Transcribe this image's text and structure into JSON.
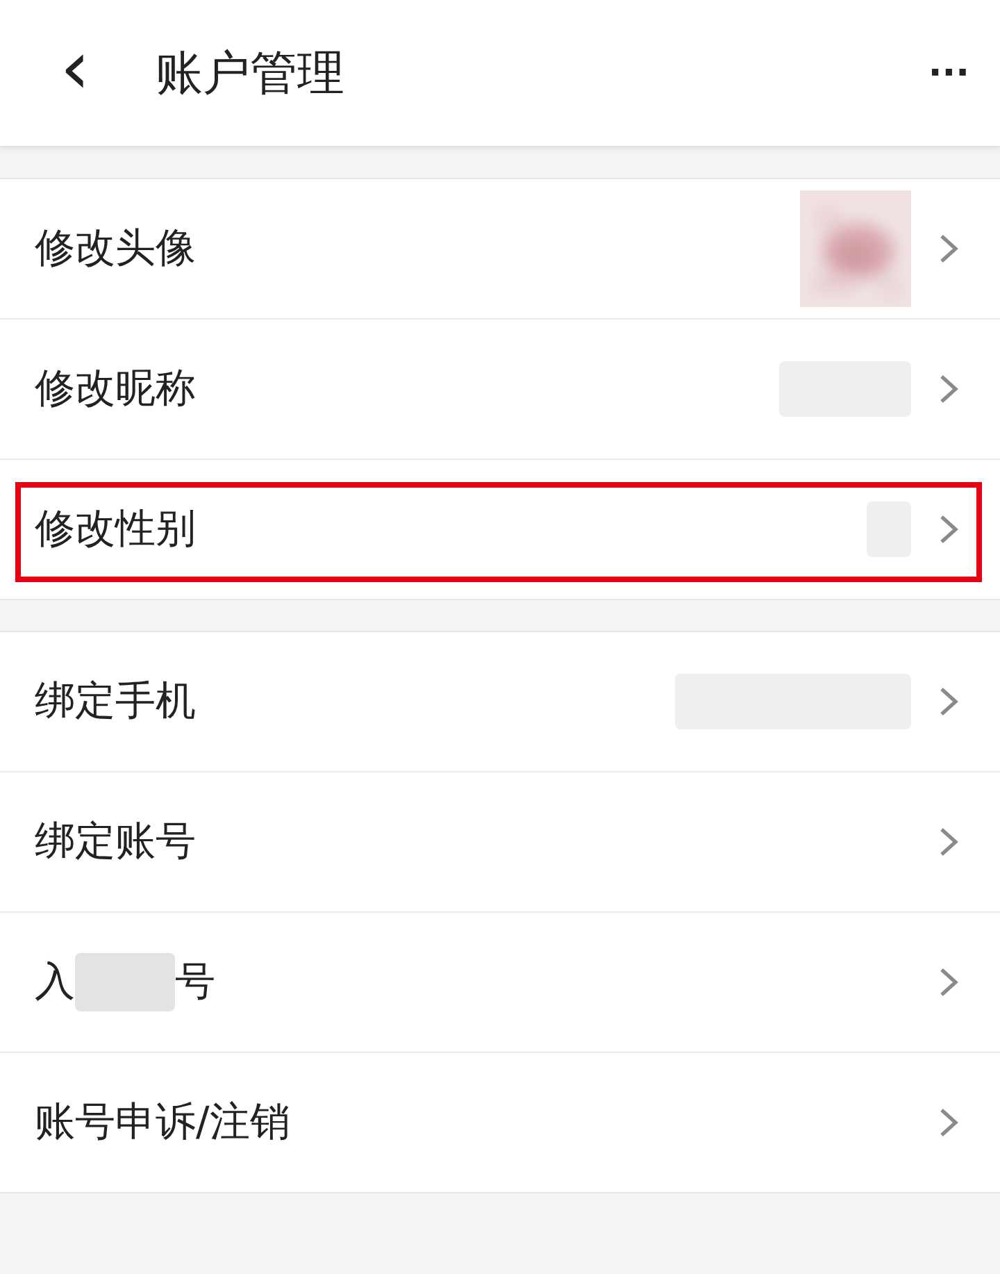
{
  "header": {
    "title": "账户管理",
    "back": "‹",
    "more": "···"
  },
  "groups": [
    {
      "rows": [
        {
          "label": "修改头像",
          "kind": "avatar",
          "highlighted": false
        },
        {
          "label": "修改昵称",
          "kind": "nickname",
          "highlighted": false
        },
        {
          "label": "修改性别",
          "kind": "gender",
          "highlighted": true
        }
      ]
    },
    {
      "rows": [
        {
          "label": "绑定手机",
          "kind": "phone",
          "highlighted": false
        },
        {
          "label": "绑定账号",
          "kind": "plain",
          "highlighted": false
        },
        {
          "label": "入",
          "label_end": "号",
          "kind": "plain",
          "highlighted": false
        },
        {
          "label": "账号申诉/注销",
          "kind": "plain",
          "highlighted": false
        }
      ]
    }
  ]
}
